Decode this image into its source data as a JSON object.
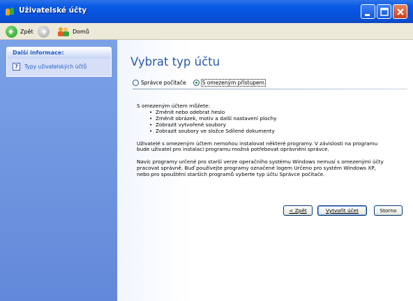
{
  "window": {
    "title": "Uživatelské účty",
    "icon": "user-accounts-icon",
    "controls": [
      "minimize",
      "maximize",
      "close"
    ]
  },
  "toolbar": {
    "back_label": "Zpět",
    "forward_icon": "forward-arrow-icon",
    "home_label": "Domů"
  },
  "sidebar": {
    "panel_title": "Další informace:",
    "items": [
      {
        "icon": "help-icon",
        "label": "Typy uživatelských účtů"
      }
    ]
  },
  "main": {
    "title": "Vybrat typ účtu",
    "options": [
      {
        "label": "Správce počítače",
        "selected": false
      },
      {
        "label": "S omezeným přístupem",
        "selected": true
      }
    ],
    "intro": "S omezeným účtem můžete:",
    "bullets": [
      "Změnit nebo odebrat heslo",
      "Změnit obrázek, motiv a další nastavení plochy",
      "Zobrazit vytvořené soubory",
      "Zobrazit soubory ve složce Sdílené dokumenty"
    ],
    "para1_line1": "Uživatelé s omezeným účtem nemohou instalovat některé programy. V závislosti na programu",
    "para1_line2": "bude uživatel pro instalaci programu možná potřebovat oprávnění správce.",
    "para2_line1": "Navíc programy určené pro starší verze operačního systému Windows nemusí s omezenými účty",
    "para2_line2": "pracovat správně. Buď používejte programy označené logem Určeno pro systém Windows XP,",
    "para2_line3": "nebo pro spouštění starších programů vyberte typ účtu Správce počítače."
  },
  "buttons": {
    "back": "< Zpět",
    "create": "Vytvořit účet",
    "cancel": "Storno"
  },
  "colors": {
    "titlebar": "#0654e0",
    "sidebar": "#6f95e0",
    "heading": "#2a5aa7",
    "link": "#215dc6"
  }
}
